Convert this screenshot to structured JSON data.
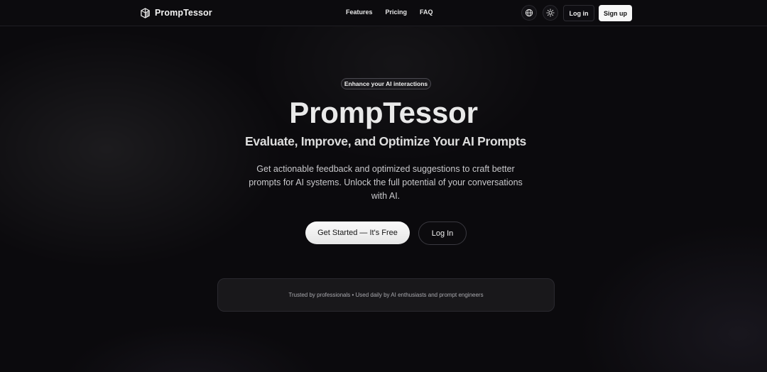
{
  "header": {
    "brand": "PrompTessor",
    "nav": [
      "Features",
      "Pricing",
      "FAQ"
    ],
    "login_label": "Log in",
    "signup_label": "Sign up"
  },
  "icons": {
    "language": "globe-icon",
    "theme": "sun-icon",
    "logo": "cube-logo-icon"
  },
  "hero": {
    "badge": "Enhance your AI interactions",
    "title": "PrompTessor",
    "subtitle": "Evaluate, Improve, and Optimize Your AI Prompts",
    "description": "Get actionable feedback and optimized suggestions to craft better prompts for AI systems. Unlock the full potential of your conversations with AI.",
    "cta_primary": "Get Started — It's Free",
    "cta_secondary": "Log In",
    "trust_text": "Trusted by professionals • Used daily by AI enthusiasts and prompt engineers"
  },
  "colors": {
    "background": "#0b0a0d",
    "primary_button": "#f7f7f7",
    "text": "#e9e9e9"
  }
}
